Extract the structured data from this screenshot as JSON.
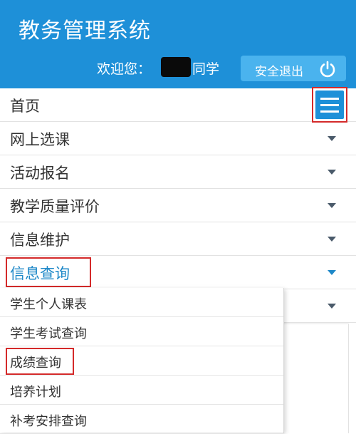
{
  "header": {
    "title": "教务管理系统",
    "welcome_prefix": "欢迎您：",
    "welcome_suffix": "同学",
    "logout_label": "安全退出",
    "logout_icon": "power-icon",
    "bg_color": "#1e90d8"
  },
  "menu": {
    "toggle_icon": "hamburger-menu-icon",
    "items": [
      {
        "label": "首页"
      },
      {
        "label": "网上选课"
      },
      {
        "label": "活动报名"
      },
      {
        "label": "教学质量评价"
      },
      {
        "label": "信息维护"
      },
      {
        "label": "信息查询"
      }
    ]
  },
  "dropdown": {
    "items": [
      {
        "label": "学生个人课表"
      },
      {
        "label": "学生考试查询"
      },
      {
        "label": "成绩查询"
      },
      {
        "label": "培养计划"
      },
      {
        "label": "补考安排查询"
      }
    ]
  },
  "colors": {
    "accent": "#1e88c8",
    "highlight": "#d42a2a"
  }
}
